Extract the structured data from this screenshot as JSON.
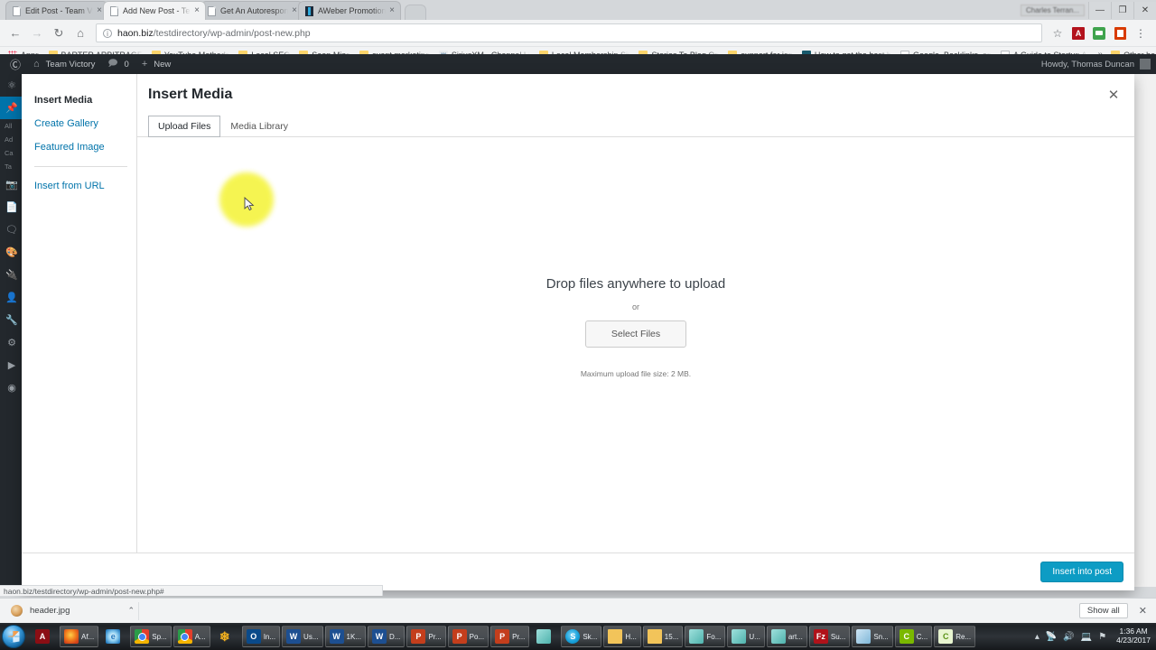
{
  "browser": {
    "tabs": [
      {
        "title": "Edit Post - Team Victory",
        "favicon": "page-icon",
        "active": false
      },
      {
        "title": "Add New Post - Team Vi",
        "favicon": "page-icon",
        "active": true
      },
      {
        "title": "Get An Autoresponder -",
        "favicon": "page-icon",
        "active": false
      },
      {
        "title": "AWeber Promotional Vi",
        "favicon": "aweber-icon",
        "active": false
      }
    ],
    "close_label": "×",
    "window_user": "Charles Terran...",
    "window_controls": {
      "minimize": "—",
      "maximize": "❐",
      "close": "✕"
    },
    "nav": {
      "back": "←",
      "forward": "→",
      "reload": "↻",
      "home": "⌂"
    },
    "omnibox": {
      "info_glyph": "i",
      "url_strong": "haon.biz",
      "url_rest": "/testdirectory/wp-admin/post-new.php",
      "star": "☆"
    },
    "extensions": [
      {
        "name": "acrobat-extension",
        "label": "A"
      },
      {
        "name": "green-extension",
        "label": ""
      },
      {
        "name": "office-extension",
        "label": ""
      }
    ],
    "menu_glyph": "⋮",
    "bookmarks": [
      {
        "label": "Apps",
        "icon": "apps-grid-icon"
      },
      {
        "label": "BARTER ARBITRAGE",
        "icon": "folder-icon"
      },
      {
        "label": "YouTube Methods",
        "icon": "folder-icon"
      },
      {
        "label": "Local SEO",
        "icon": "folder-icon"
      },
      {
        "label": "Sean Mize",
        "icon": "folder-icon"
      },
      {
        "label": "event marketing",
        "icon": "folder-icon"
      },
      {
        "label": "SiriusXM - Channel Li",
        "icon": "siriusxm-icon"
      },
      {
        "label": "Local Membership Sit",
        "icon": "folder-icon"
      },
      {
        "label": "Stories To Blog On",
        "icon": "folder-icon"
      },
      {
        "label": "support for jon",
        "icon": "folder-icon"
      },
      {
        "label": "How to get the best h",
        "icon": "dark-site-icon"
      },
      {
        "label": "Google, Backlinks, an",
        "icon": "page-icon"
      },
      {
        "label": "A Guide to Startup A",
        "icon": "page-icon"
      }
    ],
    "bookmarks_overflow": "»",
    "other_bookmarks": "Other bookmarks",
    "status_url": "haon.biz/testdirectory/wp-admin/post-new.php#"
  },
  "wordpress": {
    "adminbar": {
      "logo": "wordpress-logo",
      "site_name": "Team Victory",
      "comment_count": "0",
      "new_label": "New",
      "howdy": "Howdy, Thomas Duncan"
    },
    "sidebar_icons": [
      "dashboard-icon",
      "posts-icon",
      "media-icon",
      "pages-icon",
      "comments-icon",
      "appearance-icon",
      "plugins-icon",
      "users-icon",
      "tools-icon",
      "settings-icon",
      "collapse-icon",
      "extra-icon"
    ],
    "sidebar_sub": [
      "All",
      "Ad",
      "Ca",
      "Ta"
    ]
  },
  "modal": {
    "close_glyph": "✕",
    "title": "Insert Media",
    "menu": [
      {
        "label": "Insert Media",
        "active": true
      },
      {
        "label": "Create Gallery",
        "active": false
      },
      {
        "label": "Featured Image",
        "active": false
      },
      {
        "label": "Insert from URL",
        "active": false,
        "after_sep": true
      }
    ],
    "tabs": [
      {
        "label": "Upload Files",
        "active": true
      },
      {
        "label": "Media Library",
        "active": false
      }
    ],
    "dropzone": {
      "title": "Drop files anywhere to upload",
      "or": "or",
      "button": "Select Files",
      "max_size": "Maximum upload file size: 2 MB."
    },
    "footer_button": "Insert into post"
  },
  "downloads": {
    "item_name": "header.jpg",
    "item_chevron": "⌃",
    "show_all": "Show all",
    "close": "✕"
  },
  "taskbar": {
    "start": "start-orb",
    "items": [
      {
        "label": "",
        "icon": "acrobat-icon",
        "pinned": true
      },
      {
        "label": "Af...",
        "icon": "firefox-icon",
        "pinned": false
      },
      {
        "label": "",
        "icon": "internet-explorer-icon",
        "pinned": true
      },
      {
        "label": "Sp...",
        "icon": "chrome-icon",
        "pinned": false
      },
      {
        "label": "A...",
        "icon": "chrome-icon",
        "pinned": false
      },
      {
        "label": "",
        "icon": "flower-icon",
        "pinned": true
      },
      {
        "label": "In...",
        "icon": "outlook-icon",
        "pinned": false
      },
      {
        "label": "Us...",
        "icon": "word-icon",
        "pinned": false
      },
      {
        "label": "1K...",
        "icon": "word-icon",
        "pinned": false
      },
      {
        "label": "D...",
        "icon": "word-icon",
        "pinned": false
      },
      {
        "label": "Pr...",
        "icon": "powerpoint-icon",
        "pinned": false
      },
      {
        "label": "Po...",
        "icon": "powerpoint-icon",
        "pinned": false
      },
      {
        "label": "Pr...",
        "icon": "powerpoint-icon",
        "pinned": false
      },
      {
        "label": "",
        "icon": "app-icon",
        "pinned": true
      },
      {
        "label": "Sk...",
        "icon": "skype-icon",
        "pinned": false
      },
      {
        "label": "H...",
        "icon": "folder-icon",
        "pinned": false
      },
      {
        "label": "15...",
        "icon": "folder-icon",
        "pinned": false
      },
      {
        "label": "Fo...",
        "icon": "explorer-icon",
        "pinned": false
      },
      {
        "label": "U...",
        "icon": "explorer-icon",
        "pinned": false
      },
      {
        "label": "art...",
        "icon": "explorer-icon",
        "pinned": false
      },
      {
        "label": "Su...",
        "icon": "filezilla-icon",
        "pinned": false
      },
      {
        "label": "Sn...",
        "icon": "snagit-icon",
        "pinned": false
      },
      {
        "label": "C...",
        "icon": "camtasia-icon",
        "pinned": false
      },
      {
        "label": "Re...",
        "icon": "camtasia-icon",
        "pinned": false
      }
    ],
    "tray": {
      "expand": "▴",
      "icons": [
        "network-icon",
        "volume-icon",
        "action-center-icon",
        "flag-icon"
      ],
      "time": "1:36 AM",
      "date": "4/23/2017"
    }
  },
  "colors": {
    "wp_admin_dark": "#23282d",
    "wp_blue": "#0073aa",
    "insert_button": "#0d9cc4",
    "cursor_highlight": "#f5f443"
  }
}
